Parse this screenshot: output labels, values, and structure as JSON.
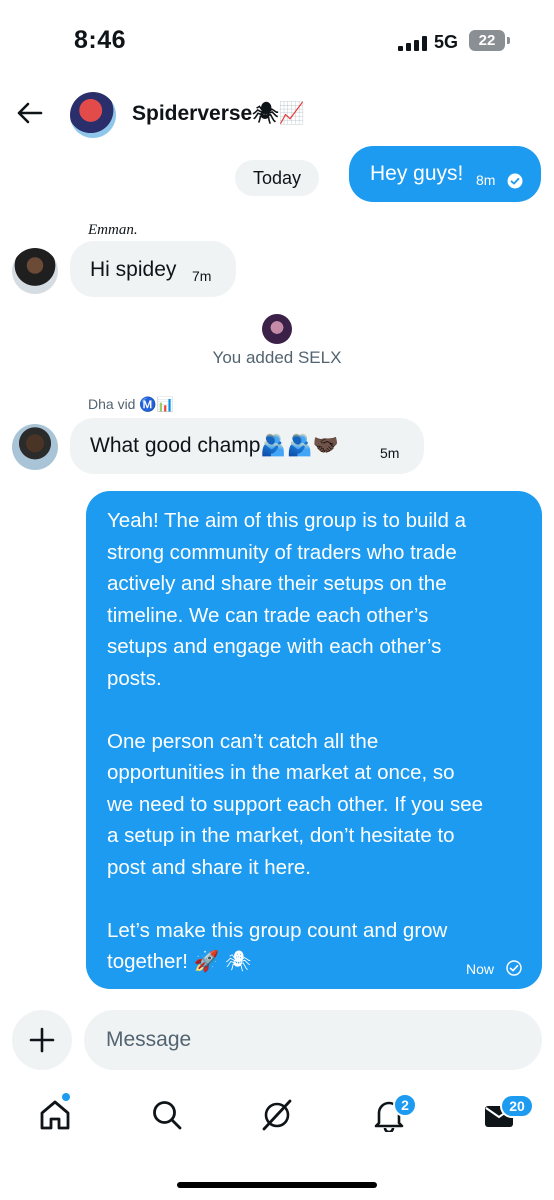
{
  "status_bar": {
    "time": "8:46",
    "network": "5G",
    "battery": "22"
  },
  "header": {
    "group_name": "Spiderverse🕷📈"
  },
  "date_chip": "Today",
  "messages": [
    {
      "from": "me",
      "text": "Hey guys!",
      "time": "8m"
    },
    {
      "from": "Emman.",
      "text": "Hi spidey",
      "time": "7m"
    },
    {
      "from": "Dha vid Ⓜ️📊",
      "text": "What good champ🫂🫂🤝🏿",
      "time": "5m"
    }
  ],
  "system_message": "You added SELX",
  "long_message": {
    "text": "Yeah! The aim of this group is to build a\nstrong community of traders who trade\nactively and share their setups on the\ntimeline. We can trade each other’s\nsetups and engage with each other’s\nposts.\n\nOne person can’t catch all the\nopportunities in the market at once, so\nwe need to support each other. If you see\na setup in the market, don’t hesitate to\npost and share it here.\n\nLet’s make this group count and grow\ntogether! 🚀 🕷",
    "time": "Now"
  },
  "composer": {
    "placeholder": "Message"
  },
  "nav": {
    "items": [
      "home-icon",
      "search-icon",
      "grok-icon",
      "bell-icon",
      "mail-icon"
    ],
    "notifications_badge": "2",
    "messages_badge": "20"
  },
  "colors": {
    "accent": "#1d9bf0",
    "incoming_bubble": "#eff3f4"
  }
}
